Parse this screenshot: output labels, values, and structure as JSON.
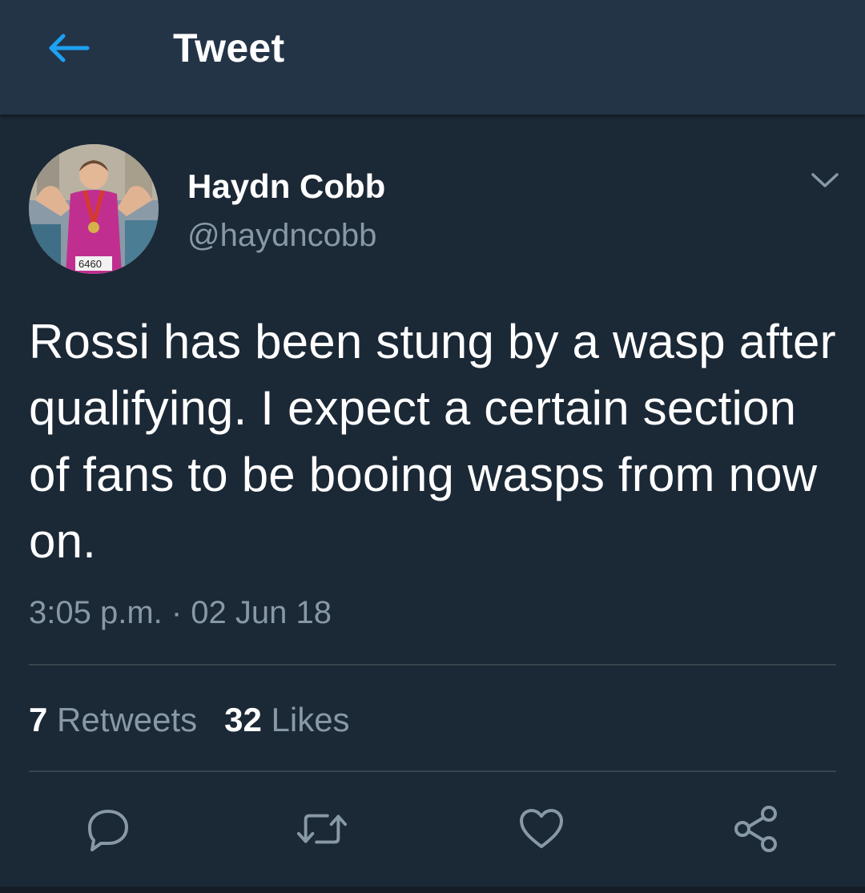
{
  "header": {
    "title": "Tweet",
    "back_icon": "arrow-left-icon"
  },
  "colors": {
    "background": "#1b2836",
    "header_background": "#243447",
    "accent": "#1da1f2",
    "secondary_text": "#8899a6"
  },
  "tweet": {
    "author": {
      "display_name": "Haydn Cobb",
      "handle": "@haydncobb",
      "avatar_icon": "profile-photo"
    },
    "text": "Rossi has been stung by a wasp after qualifying. I expect a certain section of fans to be booing wasps from now on.",
    "timestamp": "3:05 p.m. · 02 Jun 18",
    "stats": {
      "retweets_count": "7",
      "retweets_label": "Retweets",
      "likes_count": "32",
      "likes_label": "Likes"
    },
    "actions": [
      "reply-icon",
      "retweet-icon",
      "like-icon",
      "share-icon"
    ]
  }
}
